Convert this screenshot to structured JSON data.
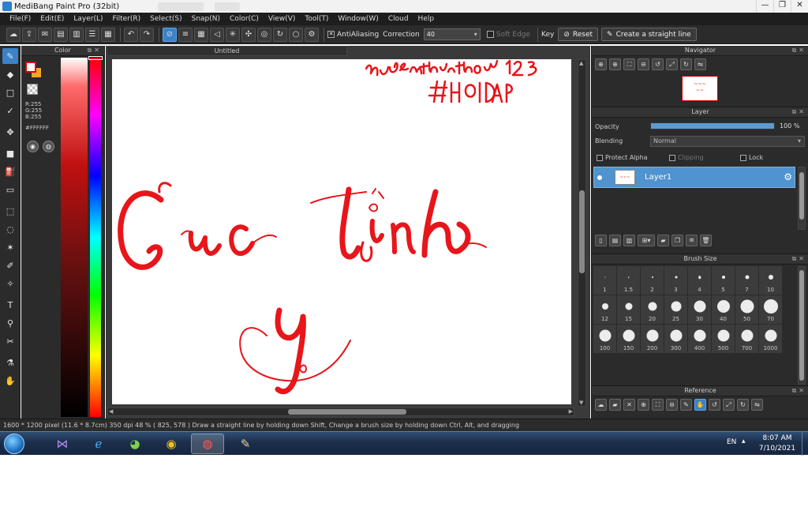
{
  "window": {
    "title": "MediBang Paint Pro (32bit)",
    "controls": {
      "minimize": "—",
      "restore": "❐",
      "close": "✕"
    }
  },
  "menu": [
    "File(F)",
    "Edit(E)",
    "Layer(L)",
    "Filter(R)",
    "Select(S)",
    "Snap(N)",
    "Color(C)",
    "View(V)",
    "Tool(T)",
    "Window(W)",
    "Cloud",
    "Help"
  ],
  "toolbar": {
    "antialiasing_label": "AntiAliasing",
    "correction_label": "Correction",
    "correction_value": "40",
    "soft_edge_label": "Soft Edge",
    "key_label": "Key",
    "reset_label": "Reset",
    "straight_line_label": "Create a straight line"
  },
  "color_panel": {
    "title": "Color",
    "r": "R:255",
    "g": "G:255",
    "b": "B:255",
    "hex": "#FFFFFF",
    "foreground_color": "#ffffff",
    "foreground_border": "#e00000",
    "background_color": "#f5a623"
  },
  "canvas": {
    "tab_title": "Untitled",
    "ink_color": "#e8151a"
  },
  "navigator": {
    "title": "Navigator"
  },
  "layer_panel": {
    "title": "Layer",
    "opacity_label": "Opacity",
    "opacity_value": "100 %",
    "opacity_fraction": 1.0,
    "blending_label": "Blending",
    "blending_value": "Normal",
    "protect_alpha_label": "Protect Alpha",
    "clipping_label": "Clipping",
    "lock_label": "Lock",
    "layers": [
      {
        "name": "Layer1",
        "selected": true,
        "visible": true
      }
    ]
  },
  "brush_panel": {
    "title": "Brush Size",
    "sizes": [
      "1",
      "1.5",
      "2",
      "3",
      "4",
      "5",
      "7",
      "10",
      "12",
      "15",
      "20",
      "25",
      "30",
      "40",
      "50",
      "70",
      "100",
      "150",
      "200",
      "300",
      "400",
      "500",
      "700",
      "1000"
    ]
  },
  "reference_panel": {
    "title": "Reference"
  },
  "status": {
    "text": "1600 * 1200 pixel   (11.6 * 8.7cm)  350 dpi   48 %   ( 825, 578 )   Draw a straight line by holding down Shift, Change a brush size by holding down Ctrl, Alt, and dragging"
  },
  "taskbar": {
    "language": "EN",
    "time": "8:07 AM",
    "date": "7/10/2021"
  }
}
